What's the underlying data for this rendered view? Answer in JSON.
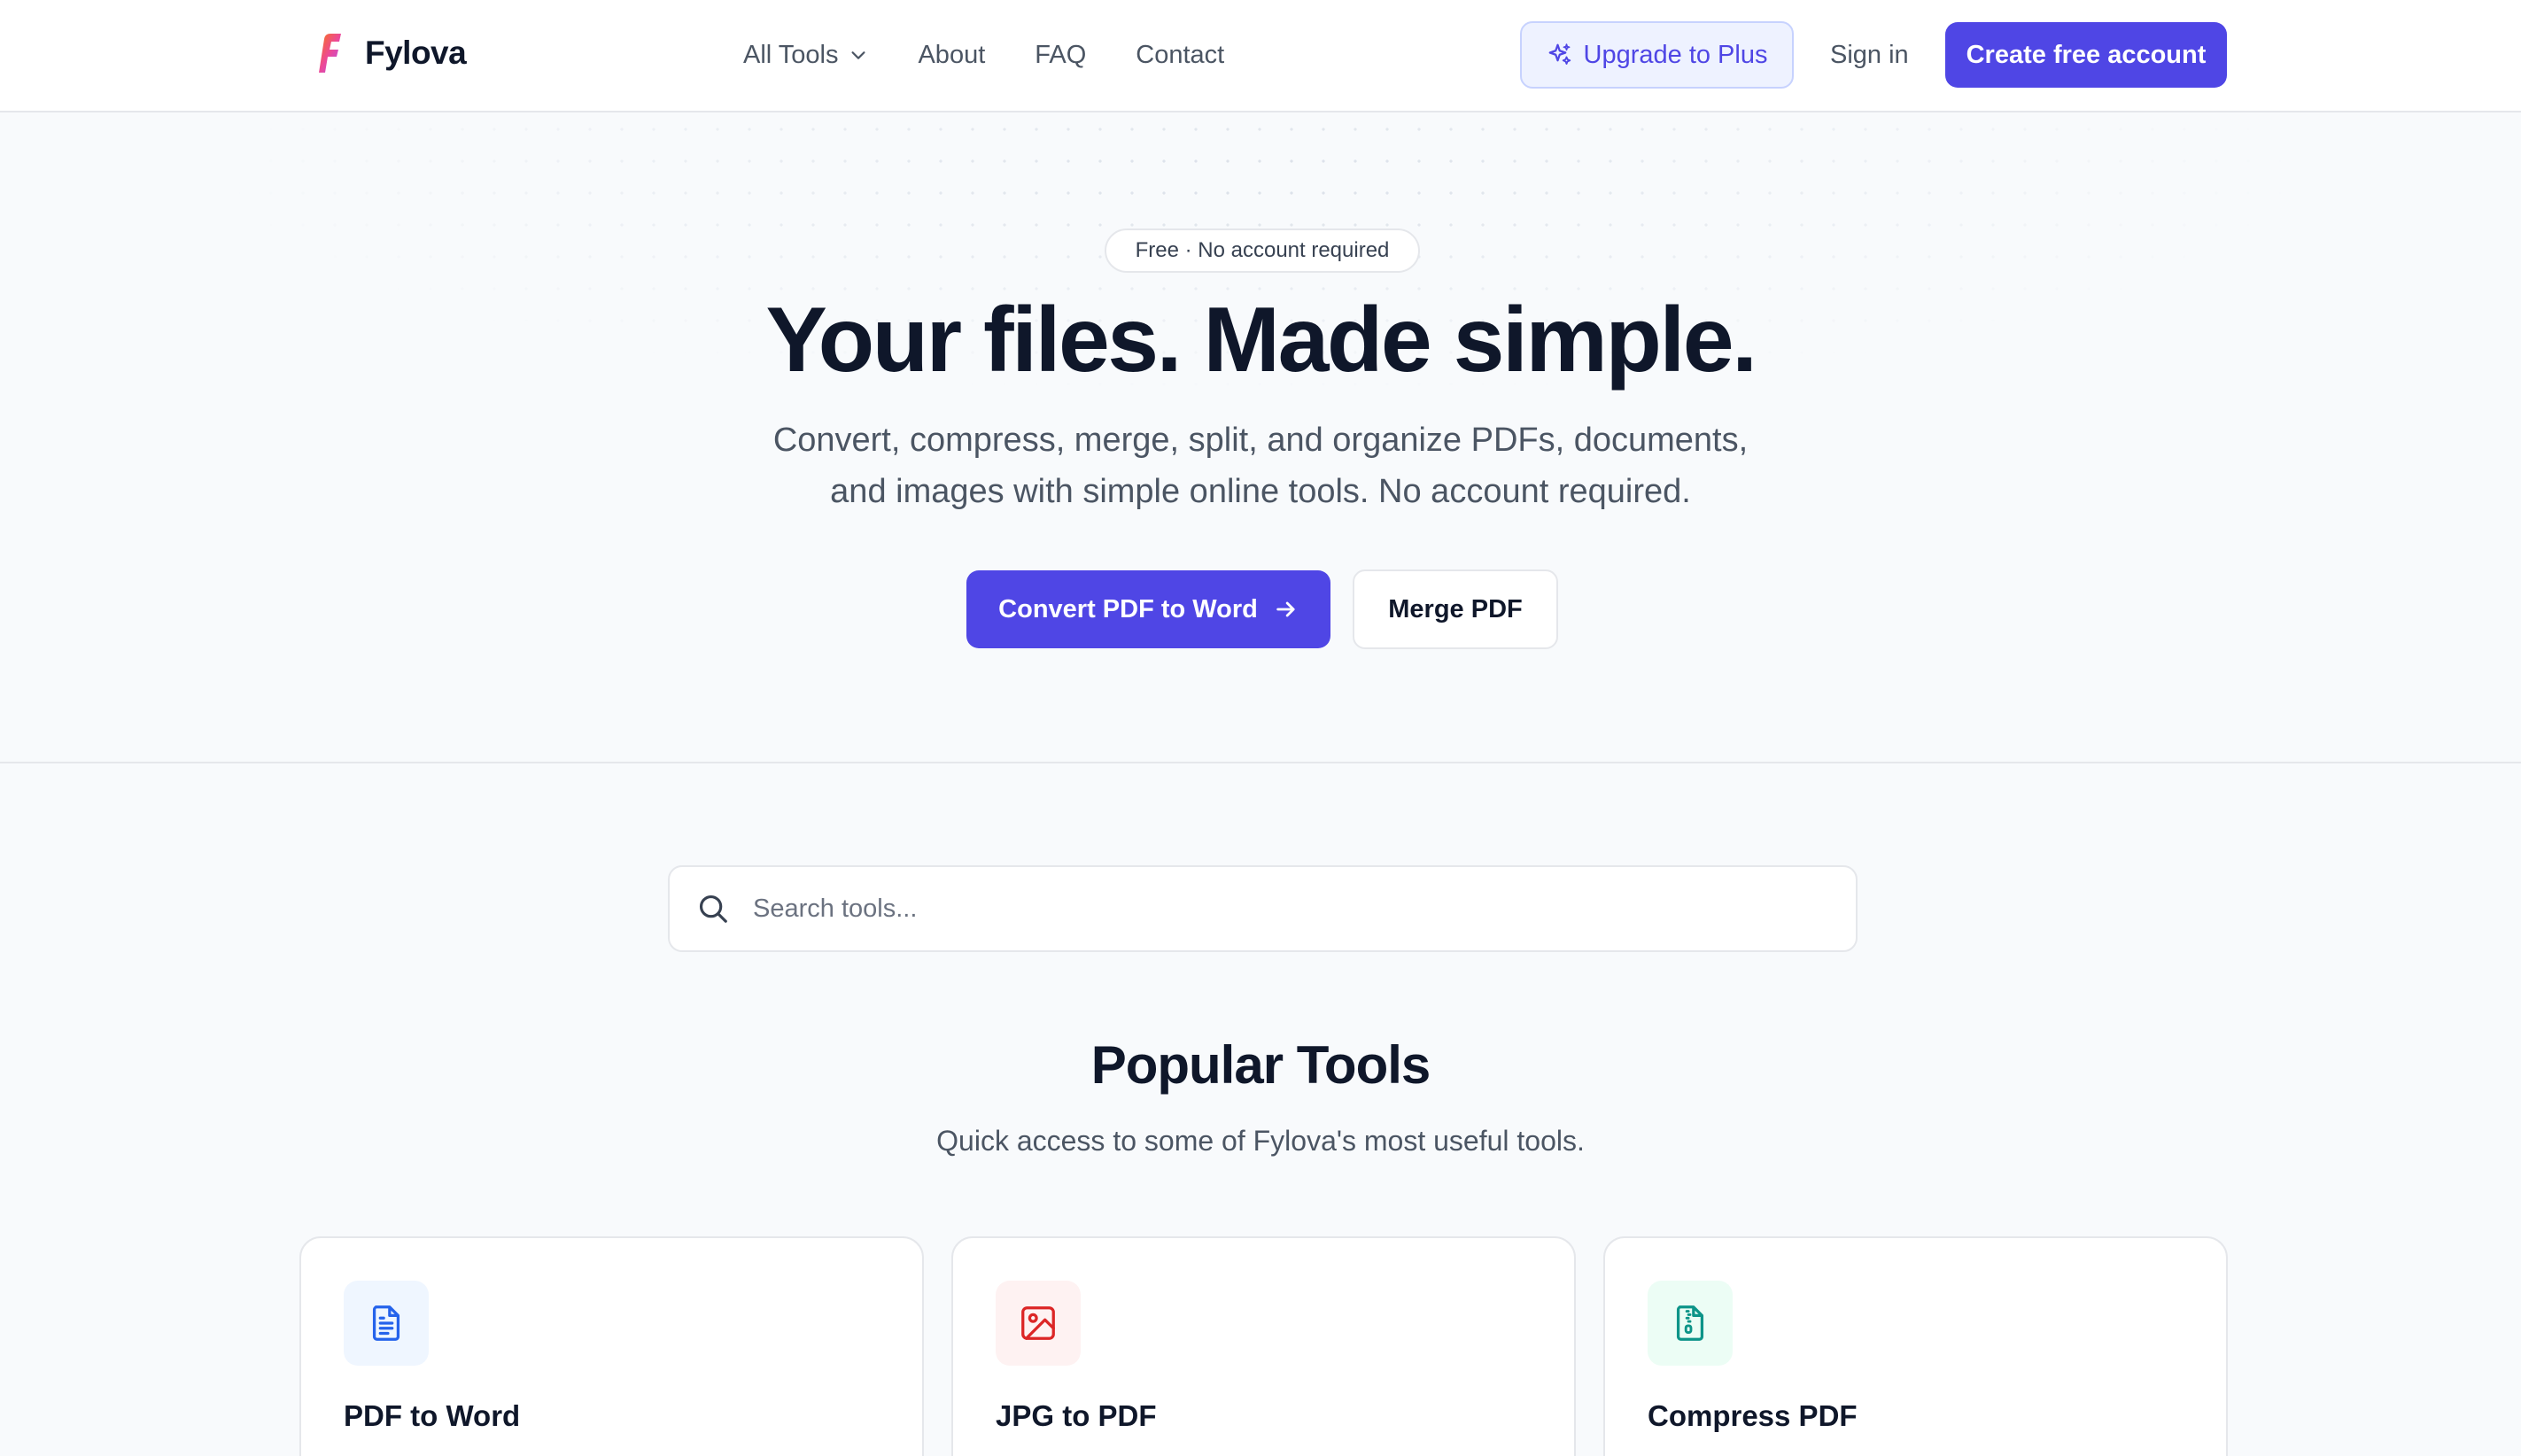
{
  "brand": {
    "name": "Fylova",
    "logo_icon": "fylova-logo-icon",
    "accent": "#4f46e5"
  },
  "nav": {
    "items": [
      {
        "label": "All Tools",
        "icon": "chevron-down-icon"
      },
      {
        "label": "About"
      },
      {
        "label": "FAQ"
      },
      {
        "label": "Contact"
      }
    ]
  },
  "header_actions": {
    "upgrade_label": "Upgrade to Plus",
    "upgrade_icon": "sparkles-icon",
    "signin_label": "Sign in",
    "create_label": "Create free account"
  },
  "hero": {
    "badge": "Free · No account required",
    "title": "Your files. Made simple.",
    "subtitle_line1": "Convert, compress, merge, split, and organize PDFs, documents,",
    "subtitle_line2": "and images with simple online tools. No account required.",
    "primary_cta": "Convert PDF to Word",
    "primary_cta_icon": "arrow-right-icon",
    "secondary_cta": "Merge PDF"
  },
  "search": {
    "placeholder": "Search tools...",
    "value": "",
    "icon": "search-icon"
  },
  "popular": {
    "title": "Popular Tools",
    "subtitle": "Quick access to some of Fylova's most useful tools.",
    "tools": [
      {
        "label": "PDF to Word",
        "icon": "document-text-icon",
        "color": "#2563eb",
        "bg": "#eff6ff"
      },
      {
        "label": "JPG to PDF",
        "icon": "image-icon",
        "color": "#dc2626",
        "bg": "#fef2f2"
      },
      {
        "label": "Compress PDF",
        "icon": "file-archive-icon",
        "color": "#0d9488",
        "bg": "#ecfdf5"
      }
    ]
  }
}
